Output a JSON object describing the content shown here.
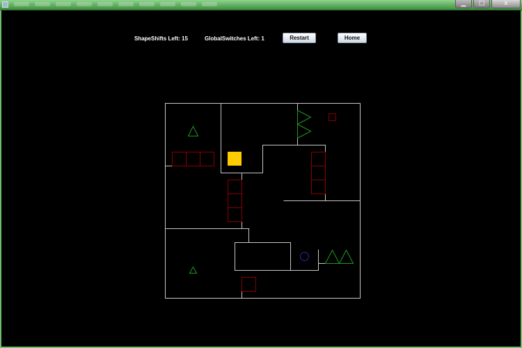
{
  "window": {
    "buttons": {
      "minimize": "▁",
      "maximize": "□",
      "close": "x"
    }
  },
  "hud": {
    "shapeshifts_label": "ShapeShifts Left:",
    "shapeshifts_value": "15",
    "globalswitches_label": "GlobalSwitches Left:",
    "globalswitches_value": "1"
  },
  "buttons": {
    "restart": "Restart",
    "home": "Home"
  },
  "colors": {
    "wall": "#c8c8c8",
    "block": "#8b0000",
    "spike": "#1e9b1e",
    "player": "#ffcc00",
    "goal": "#2a2aaa",
    "titlebar": "#5fb55f"
  },
  "icons": {
    "player": "yellow-square",
    "goal": "blue-circle",
    "hazard": "green-triangle",
    "block": "red-square-outline"
  }
}
